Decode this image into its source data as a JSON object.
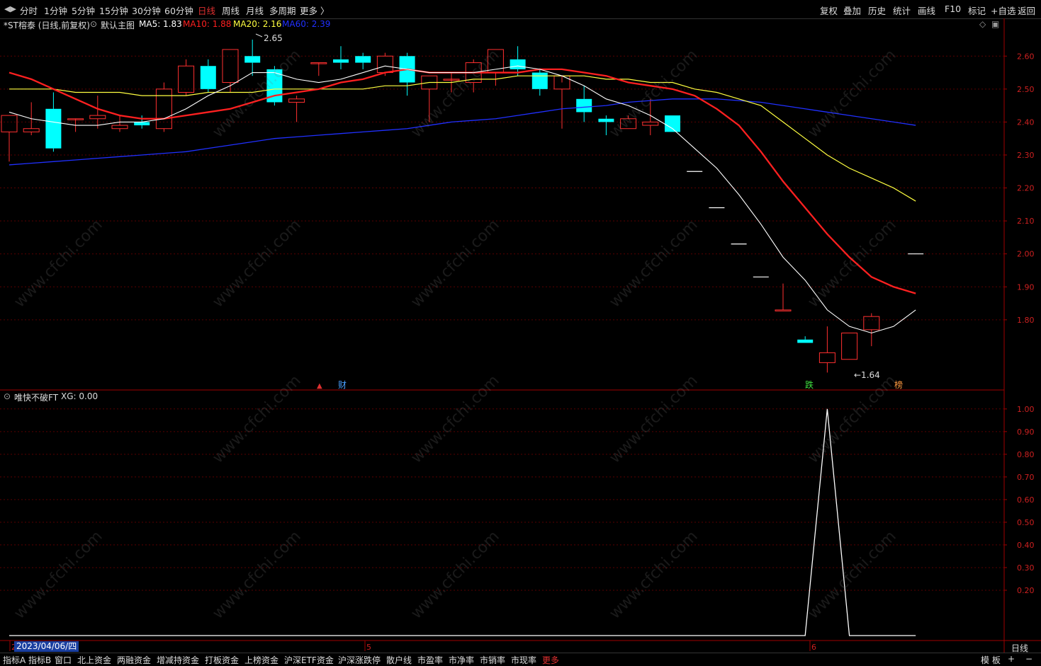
{
  "toolbar": {
    "periods": [
      "分时",
      "1分钟",
      "5分钟",
      "15分钟",
      "30分钟",
      "60分钟",
      "日线",
      "周线",
      "月线",
      "多周期",
      "更多 〉"
    ],
    "active_period": "日线",
    "right_buttons": [
      "复权",
      "叠加",
      "历史",
      "统计",
      "画线",
      "F10",
      "标记",
      "+自选",
      "返回"
    ]
  },
  "main_header": {
    "stock": "*ST榕泰 (日线,前复权)",
    "template": "默认主图",
    "ma5": "MA5: 1.83",
    "ma10": "MA10: 1.88",
    "ma20": "MA20: 2.16",
    "ma60": "MA60: 2.39",
    "colors": {
      "ma5": "#ffffff",
      "ma10": "#ff2020",
      "ma20": "#ffff40",
      "ma60": "#2030ff"
    }
  },
  "sub_header": {
    "name": "唯快不破FT",
    "xg": "XG: 0.00"
  },
  "annotations": {
    "high": "2.65",
    "low": "←1.64",
    "cai": "财",
    "die": "跌",
    "bang": "榜"
  },
  "price_axis": [
    "2.60",
    "2.50",
    "2.40",
    "2.30",
    "2.20",
    "2.10",
    "2.00",
    "1.90",
    "1.80"
  ],
  "sub_axis": [
    "1.00",
    "0.90",
    "0.80",
    "0.70",
    "0.60",
    "0.50",
    "0.40",
    "0.30",
    "0.20"
  ],
  "date_label": "2023/04/06/四",
  "x_marks": {
    "apr": "2",
    "may": "5",
    "jun": "6"
  },
  "right_label": "日线",
  "bottom_tabs": [
    "指标A",
    "指标B",
    "窗口",
    "北上资金",
    "两融资金",
    "增减持资金",
    "打板资金",
    "上榜资金",
    "沪深ETF资金",
    "沪深涨跌停",
    "散户线",
    "市盈率",
    "市净率",
    "市销率",
    "市现率",
    "更多"
  ],
  "bottom_right": [
    "模 板",
    "+",
    "−"
  ],
  "watermark": "www.cfchi.com",
  "chart_data": {
    "type": "candlestick",
    "candles": [
      [
        2.37,
        2.42,
        2.28,
        2.42
      ],
      [
        2.37,
        2.46,
        2.36,
        2.38
      ],
      [
        2.44,
        2.49,
        2.31,
        2.32
      ],
      [
        2.41,
        2.41,
        2.37,
        2.41
      ],
      [
        2.41,
        2.48,
        2.38,
        2.42
      ],
      [
        2.38,
        2.42,
        2.37,
        2.39
      ],
      [
        2.4,
        2.42,
        2.38,
        2.39
      ],
      [
        2.38,
        2.52,
        2.37,
        2.5
      ],
      [
        2.49,
        2.59,
        2.48,
        2.57
      ],
      [
        2.57,
        2.59,
        2.49,
        2.5
      ],
      [
        2.52,
        2.62,
        2.49,
        2.62
      ],
      [
        2.6,
        2.65,
        2.54,
        2.58
      ],
      [
        2.56,
        2.57,
        2.45,
        2.46
      ],
      [
        2.46,
        2.48,
        2.4,
        2.47
      ],
      [
        2.58,
        2.58,
        2.54,
        2.58
      ],
      [
        2.59,
        2.63,
        2.56,
        2.58
      ],
      [
        2.6,
        2.61,
        2.56,
        2.58
      ],
      [
        2.55,
        2.61,
        2.54,
        2.6
      ],
      [
        2.6,
        2.61,
        2.48,
        2.52
      ],
      [
        2.5,
        2.54,
        2.4,
        2.54
      ],
      [
        2.53,
        2.55,
        2.49,
        2.53
      ],
      [
        2.52,
        2.59,
        2.49,
        2.58
      ],
      [
        2.55,
        2.62,
        2.51,
        2.62
      ],
      [
        2.59,
        2.63,
        2.54,
        2.56
      ],
      [
        2.55,
        2.56,
        2.48,
        2.5
      ],
      [
        2.5,
        2.52,
        2.38,
        2.54
      ],
      [
        2.47,
        2.51,
        2.4,
        2.43
      ],
      [
        2.41,
        2.42,
        2.36,
        2.4
      ],
      [
        2.38,
        2.42,
        2.38,
        2.41
      ],
      [
        2.39,
        2.47,
        2.36,
        2.4
      ],
      [
        2.42,
        2.42,
        2.37,
        2.37
      ],
      [
        2.25,
        2.25,
        2.25,
        2.25
      ],
      [
        2.14,
        2.14,
        2.14,
        2.14
      ],
      [
        2.03,
        2.03,
        2.03,
        2.03
      ],
      [
        1.93,
        1.93,
        1.93,
        1.93
      ],
      [
        1.83,
        1.91,
        1.83,
        1.83
      ],
      [
        1.74,
        1.75,
        1.73,
        1.73
      ],
      [
        1.67,
        1.78,
        1.64,
        1.7
      ],
      [
        1.68,
        1.76,
        1.68,
        1.76
      ],
      [
        1.77,
        1.82,
        1.72,
        1.81
      ],
      [
        null,
        null,
        null,
        null
      ],
      [
        2.0,
        2.0,
        2.0,
        2.0
      ]
    ],
    "ma5": [
      2.43,
      2.41,
      2.4,
      2.39,
      2.39,
      2.4,
      2.4,
      2.41,
      2.44,
      2.48,
      2.51,
      2.55,
      2.55,
      2.53,
      2.52,
      2.53,
      2.55,
      2.57,
      2.56,
      2.55,
      2.55,
      2.55,
      2.56,
      2.57,
      2.56,
      2.54,
      2.51,
      2.47,
      2.45,
      2.42,
      2.38,
      2.32,
      2.26,
      2.18,
      2.09,
      1.99,
      1.92,
      1.83,
      1.78,
      1.76,
      1.78,
      1.83
    ],
    "ma10": [
      2.55,
      2.53,
      2.5,
      2.47,
      2.44,
      2.42,
      2.41,
      2.41,
      2.42,
      2.43,
      2.44,
      2.46,
      2.48,
      2.49,
      2.5,
      2.52,
      2.53,
      2.55,
      2.56,
      2.55,
      2.55,
      2.55,
      2.55,
      2.55,
      2.56,
      2.56,
      2.55,
      2.54,
      2.52,
      2.51,
      2.5,
      2.48,
      2.44,
      2.39,
      2.31,
      2.22,
      2.14,
      2.06,
      1.99,
      1.93,
      1.9,
      1.88
    ],
    "ma20": [
      2.5,
      2.5,
      2.5,
      2.49,
      2.49,
      2.49,
      2.48,
      2.48,
      2.48,
      2.49,
      2.49,
      2.49,
      2.5,
      2.5,
      2.5,
      2.5,
      2.5,
      2.51,
      2.51,
      2.52,
      2.52,
      2.53,
      2.53,
      2.54,
      2.54,
      2.54,
      2.54,
      2.53,
      2.53,
      2.52,
      2.52,
      2.5,
      2.49,
      2.47,
      2.45,
      2.4,
      2.35,
      2.3,
      2.26,
      2.23,
      2.2,
      2.16
    ],
    "ma60": [
      2.27,
      2.275,
      2.28,
      2.285,
      2.29,
      2.295,
      2.3,
      2.305,
      2.31,
      2.32,
      2.33,
      2.34,
      2.35,
      2.355,
      2.36,
      2.365,
      2.37,
      2.375,
      2.38,
      2.39,
      2.4,
      2.405,
      2.41,
      2.42,
      2.43,
      2.44,
      2.445,
      2.45,
      2.46,
      2.465,
      2.47,
      2.47,
      2.47,
      2.465,
      2.46,
      2.45,
      2.44,
      2.43,
      2.42,
      2.41,
      2.4,
      2.39
    ],
    "xg": [
      0,
      0,
      0,
      0,
      0,
      0,
      0,
      0,
      0,
      0,
      0,
      0,
      0,
      0,
      0,
      0,
      0,
      0,
      0,
      0,
      0,
      0,
      0,
      0,
      0,
      0,
      0,
      0,
      0,
      0,
      0,
      0,
      0,
      0,
      0,
      0,
      0,
      1,
      0,
      0,
      0,
      0
    ],
    "price_range": [
      1.6,
      2.68
    ],
    "xg_range": [
      0,
      1.04
    ],
    "colors": {
      "up": "#ff3030",
      "down": "#00ffff",
      "axis": "#a00000",
      "grid": "#5a0000"
    }
  }
}
